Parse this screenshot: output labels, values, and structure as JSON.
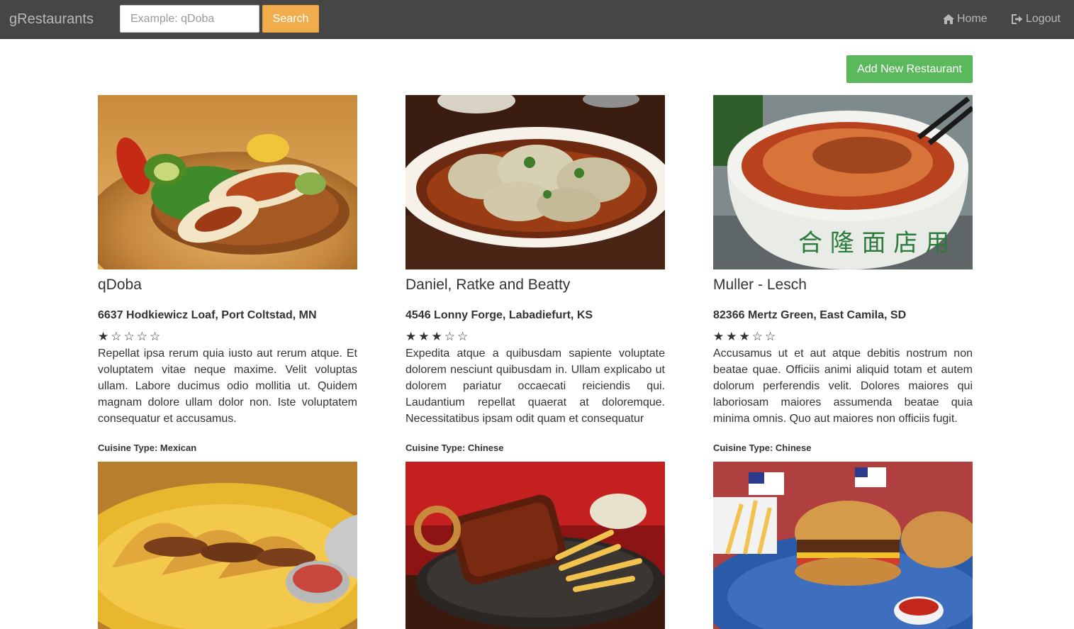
{
  "navbar": {
    "brand": "gRestaurants",
    "search_placeholder": "Example: qDoba",
    "search_label": "Search",
    "home_label": "Home",
    "logout_label": "Logout"
  },
  "actions": {
    "add_label": "Add New Restaurant"
  },
  "restaurants": [
    {
      "name": "qDoba",
      "address": "6637 Hodkiewicz Loaf, Port Coltstad, MN",
      "stars": "★☆☆☆☆",
      "rating": 1,
      "description": "Repellat ipsa rerum quia iusto aut rerum atque. Et voluptatem vitae neque maxime. Velit voluptas ullam. Labore ducimus odio mollitia ut. Quidem magnam dolore ullam dolor non. Iste voluptatem consequatur et accusamus.",
      "cuisine": "Cuisine Type: Mexican",
      "image": "burrito-platter-photo"
    },
    {
      "name": "Daniel, Ratke and Beatty",
      "address": "4546 Lonny Forge, Labadiefurt, KS",
      "stars": "★★★☆☆",
      "rating": 3,
      "description": "Expedita atque a quibusdam sapiente voluptate dolorem nesciunt quibusdam in. Ullam explicabo ut dolorem pariatur occaecati reiciendis qui. Laudantium repellat quaerat at doloremque. Necessitatibus ipsam odit quam et consequatur",
      "cuisine": "Cuisine Type: Chinese",
      "image": "dumplings-photo"
    },
    {
      "name": "Muller - Lesch",
      "address": "82366 Mertz Green, East Camila, SD",
      "stars": "★★★☆☆",
      "rating": 3,
      "description": "Accusamus ut et aut atque debitis nostrum non beatae quae. Officiis animi aliquid totam et autem dolorum perferendis velit. Dolores maiores qui laboriosam maiores assumenda beatae quia minima omnis. Quo aut maiores non officiis fugit.",
      "cuisine": "Cuisine Type: Chinese",
      "image": "noodle-bowl-photo"
    },
    {
      "image": "tacos-photo"
    },
    {
      "image": "ribs-and-fries-photo"
    },
    {
      "image": "burgers-and-fries-photo"
    }
  ],
  "colors": {
    "navbar_bg": "#464646",
    "search_button": "#f0ad4e",
    "add_button": "#5cb85c"
  }
}
